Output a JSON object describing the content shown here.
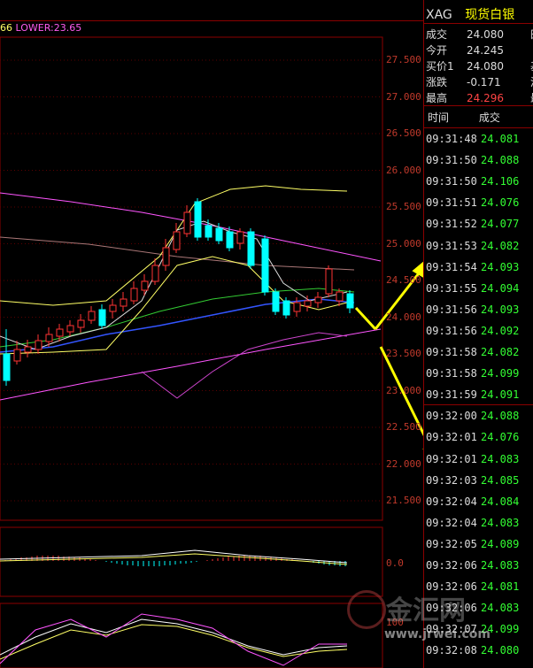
{
  "indicator": {
    "prefix": "66",
    "lower_label": "LOWER:23.65"
  },
  "price_axis": [
    "27.500",
    "27.000",
    "26.500",
    "26.000",
    "25.500",
    "25.000",
    "24.500",
    "24.000",
    "23.500",
    "23.000",
    "22.500",
    "22.000",
    "21.500"
  ],
  "macd_axis": "0.0",
  "kdj_axis": "100",
  "header": {
    "symbol": "XAG",
    "name": "现货白银"
  },
  "quote": [
    {
      "label": "成交",
      "value": "24.080",
      "color": "#dddddd"
    },
    {
      "label": "今开",
      "value": "24.245",
      "color": "#dddddd"
    },
    {
      "label": "买价1",
      "value": "24.080",
      "color": "#dddddd"
    },
    {
      "label": "涨跌",
      "value": "-0.171",
      "color": "#dddddd"
    },
    {
      "label": "最高",
      "value": "24.296",
      "color": "#ff4444"
    }
  ],
  "quote_right_chars": [
    "田",
    "",
    "基",
    "涉",
    "最"
  ],
  "ticks_header": {
    "time": "时间",
    "price": "成交"
  },
  "ticks": [
    {
      "time": "09:31:48",
      "price": "24.081"
    },
    {
      "time": "09:31:50",
      "price": "24.088"
    },
    {
      "time": "09:31:50",
      "price": "24.106"
    },
    {
      "time": "09:31:51",
      "price": "24.076"
    },
    {
      "time": "09:31:52",
      "price": "24.077"
    },
    {
      "time": "09:31:53",
      "price": "24.082"
    },
    {
      "time": "09:31:54",
      "price": "24.093"
    },
    {
      "time": "09:31:55",
      "price": "24.094"
    },
    {
      "time": "09:31:56",
      "price": "24.093"
    },
    {
      "time": "09:31:56",
      "price": "24.092"
    },
    {
      "time": "09:31:58",
      "price": "24.082"
    },
    {
      "time": "09:31:58",
      "price": "24.099"
    },
    {
      "time": "09:31:59",
      "price": "24.091"
    },
    {
      "time": "09:32:00",
      "price": "24.088"
    },
    {
      "time": "09:32:01",
      "price": "24.076"
    },
    {
      "time": "09:32:01",
      "price": "24.083"
    },
    {
      "time": "09:32:03",
      "price": "24.085"
    },
    {
      "time": "09:32:04",
      "price": "24.084"
    },
    {
      "time": "09:32:04",
      "price": "24.083"
    },
    {
      "time": "09:32:05",
      "price": "24.089"
    },
    {
      "time": "09:32:06",
      "price": "24.083"
    },
    {
      "time": "09:32:06",
      "price": "24.081"
    },
    {
      "time": "09:32:06",
      "price": "24.083"
    },
    {
      "time": "09:32:07",
      "price": "24.099"
    },
    {
      "time": "09:32:08",
      "price": "24.080"
    }
  ],
  "watermark": {
    "text": "金汇网",
    "url": "www.jrwei.com"
  },
  "colors": {
    "up": "#ff3333",
    "down": "#00ffff",
    "arrow": "#ffff00",
    "grid": "#8b0000",
    "tick_price": "#33ff33"
  }
}
